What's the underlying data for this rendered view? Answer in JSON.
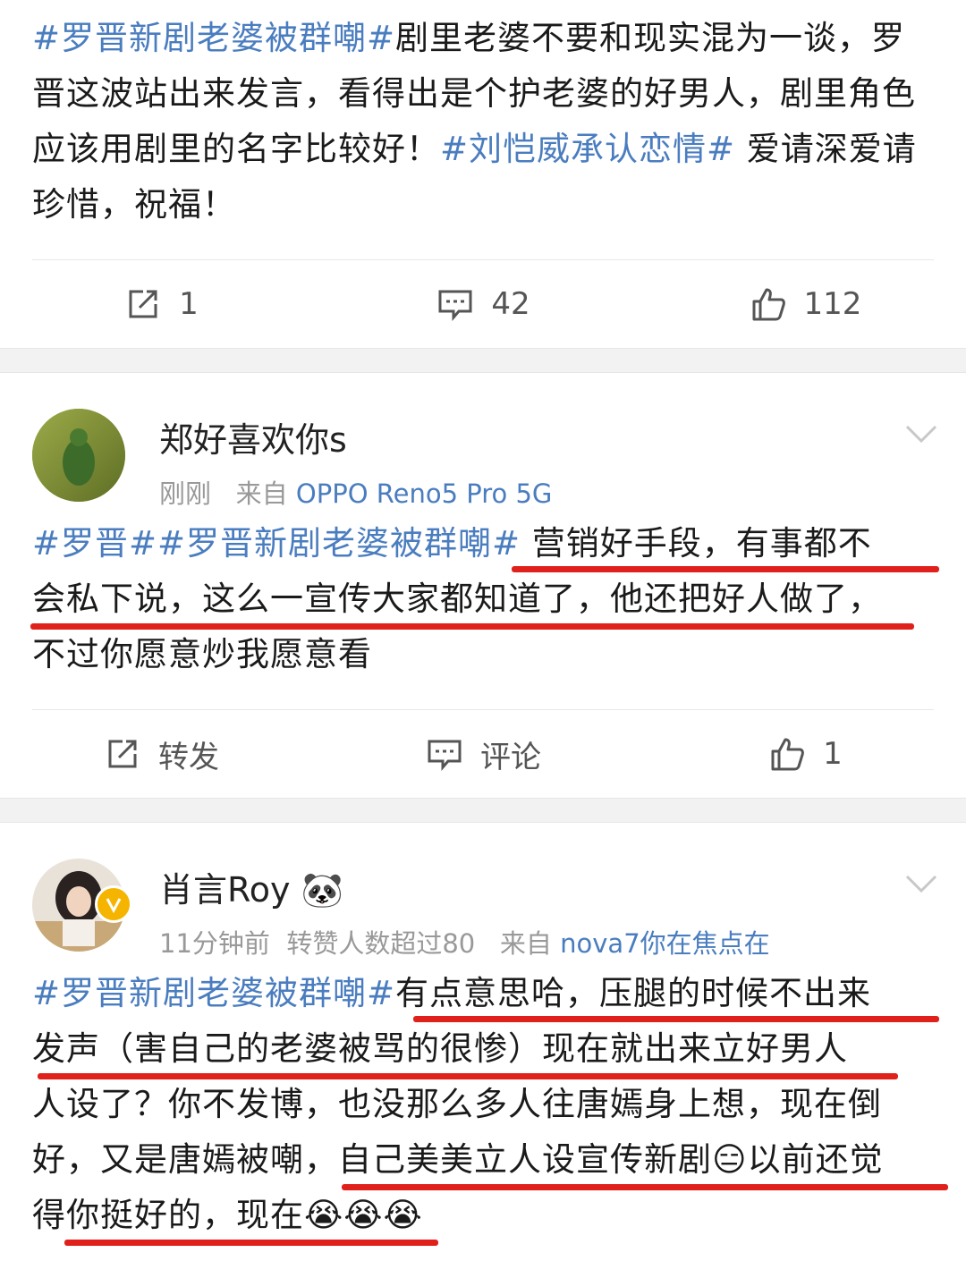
{
  "post1": {
    "text": {
      "tag1": "#罗晋新剧老婆被群嘲#",
      "seg1": "剧里老婆不要和现实混为一谈，罗晋这波站出来发言，看得出是个护老婆的好男人，剧里角色应该用剧里的名字比较好！",
      "tag2": "#刘恺威承认恋情#",
      "seg2": " 爱请深爱请珍惜，祝福！"
    },
    "actions": {
      "repost": "1",
      "comment": "42",
      "like": "112"
    }
  },
  "post2": {
    "username": "郑好喜欢你s",
    "time": "刚刚",
    "from_label": "来自",
    "source": "OPPO Reno5 Pro 5G",
    "text": {
      "tag1": "#罗晋#",
      "tag2": "#罗晋新剧老婆被群嘲#",
      "hl1": " 营销好手段，有事都不",
      "hl2": "会私下说，这么一宣传大家都知道了，他还把好人做了，",
      "seg3": "不过你愿意炒我愿意看"
    },
    "actions": {
      "repost": "转发",
      "comment": "评论",
      "like": "1"
    }
  },
  "post3": {
    "username": "肖言Roy",
    "username_emoji": "🐼",
    "time": "11分钟前",
    "stats": "转赞人数超过80",
    "from_label": "来自",
    "source": "nova7你在焦点在",
    "text": {
      "tag1": "#罗晋新剧老婆被群嘲#",
      "hl1": "有点意思哈，压腿的时候不出来",
      "hl2": "发声（害自己的老婆被骂的很惨）现在就出来立好男人",
      "seg3": "人设了？你不发博，也没那么多人往唐嫣身上想，现在倒好，又是唐嫣被嘲，",
      "hl3": "自己美美立人设宣传新剧",
      "emoji1": "😑",
      "hl4": "以前还觉",
      "seg4": "得",
      "hl5": "你挺好的，现在",
      "emoji2": "😭😭😭"
    }
  },
  "colors": {
    "link": "#4a7dbf",
    "underline": "#e0201b",
    "verified": "#f5b400"
  }
}
